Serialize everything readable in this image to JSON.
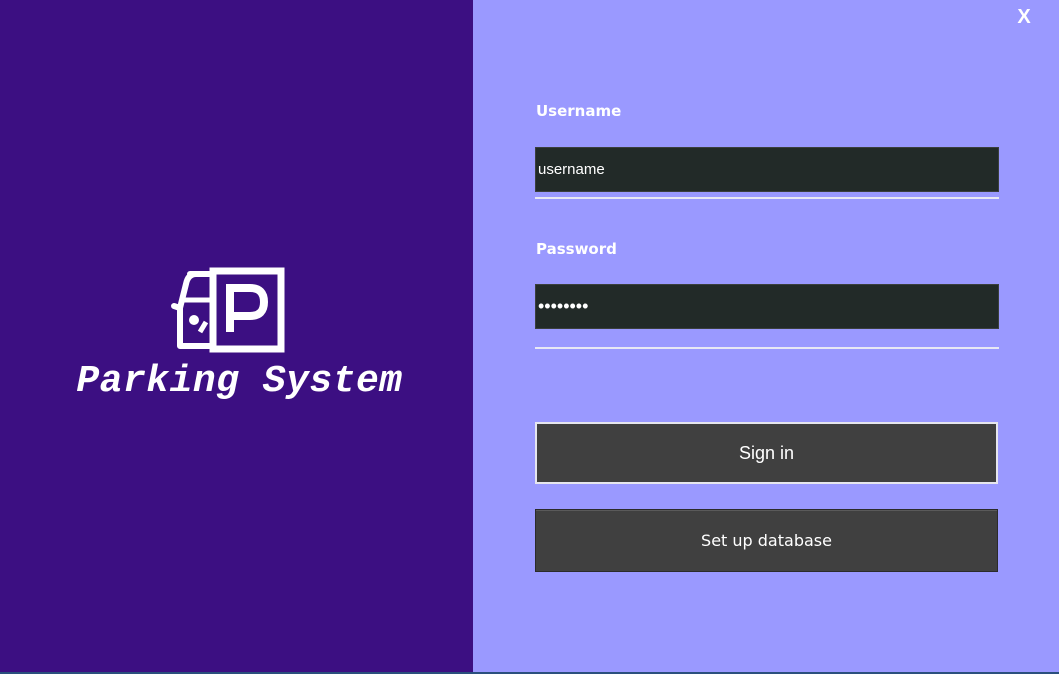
{
  "app": {
    "title": "Parking System",
    "logo_icon": "car-parking-icon"
  },
  "window": {
    "close_label": "X"
  },
  "login": {
    "username_label": "Username",
    "username_value": "username",
    "password_label": "Password",
    "password_value": "password",
    "signin_label": "Sign in",
    "setup_label": "Set up database"
  },
  "colors": {
    "left_panel": "#3c0f82",
    "right_panel": "#9a99ff",
    "field_background": "#222a28",
    "button_background": "#404040",
    "text": "#ffffff"
  }
}
